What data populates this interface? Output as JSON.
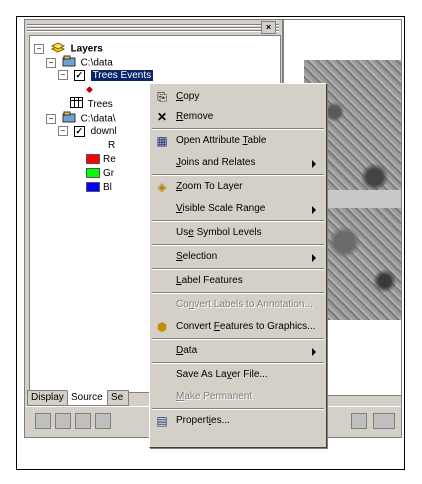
{
  "toc": {
    "close_glyph": "×",
    "layers_label": "Layers",
    "folder1_label": "C:\\data",
    "trees_events_label": "Trees Events",
    "trees_label": "Trees",
    "folder2_label": "C:\\data\\",
    "download_label": "downl",
    "band_r_label": "R",
    "legend": [
      {
        "label": "Re",
        "color": "#ff0000"
      },
      {
        "label": "Gr",
        "color": "#00ff00"
      },
      {
        "label": "Bl",
        "color": "#0000ff"
      }
    ]
  },
  "tabs": [
    {
      "label": "Display"
    },
    {
      "label": "Source"
    },
    {
      "label": "Se"
    }
  ],
  "menu": {
    "items": [
      {
        "key": "copy",
        "label": "Copy",
        "icon": "copy-icon",
        "glyph": "⎘"
      },
      {
        "key": "remove",
        "label": "Remove",
        "icon": "remove-icon",
        "glyph": "✕"
      },
      {
        "key": "open_attribute_table",
        "label": "Open Attribute Table",
        "icon": "table-icon",
        "glyph": "▦"
      },
      {
        "key": "joins_relates",
        "label": "Joins and Relates",
        "submenu": true
      },
      {
        "key": "zoom_to_layer",
        "label": "Zoom To Layer",
        "icon": "zoom-layer-icon",
        "glyph": "◈"
      },
      {
        "key": "visible_scale_range",
        "label": "Visible Scale Range",
        "submenu": true
      },
      {
        "key": "use_symbol_levels",
        "label": "Use Symbol Levels"
      },
      {
        "key": "selection",
        "label": "Selection",
        "submenu": true
      },
      {
        "key": "label_features",
        "label": "Label Features"
      },
      {
        "key": "convert_labels",
        "label": "Convert Labels to Annotation...",
        "disabled": true
      },
      {
        "key": "convert_features",
        "label": "Convert Features to Graphics...",
        "icon": "convert-icon",
        "glyph": "⬢"
      },
      {
        "key": "data",
        "label": "Data",
        "submenu": true
      },
      {
        "key": "save_layer_file",
        "label": "Save As Layer File..."
      },
      {
        "key": "make_permanent",
        "label": "Make Permanent",
        "disabled": true
      },
      {
        "key": "properties",
        "label": "Properties...",
        "icon": "properties-icon",
        "glyph": "▤"
      }
    ]
  },
  "scroll": {
    "left_arrow": "◄"
  }
}
